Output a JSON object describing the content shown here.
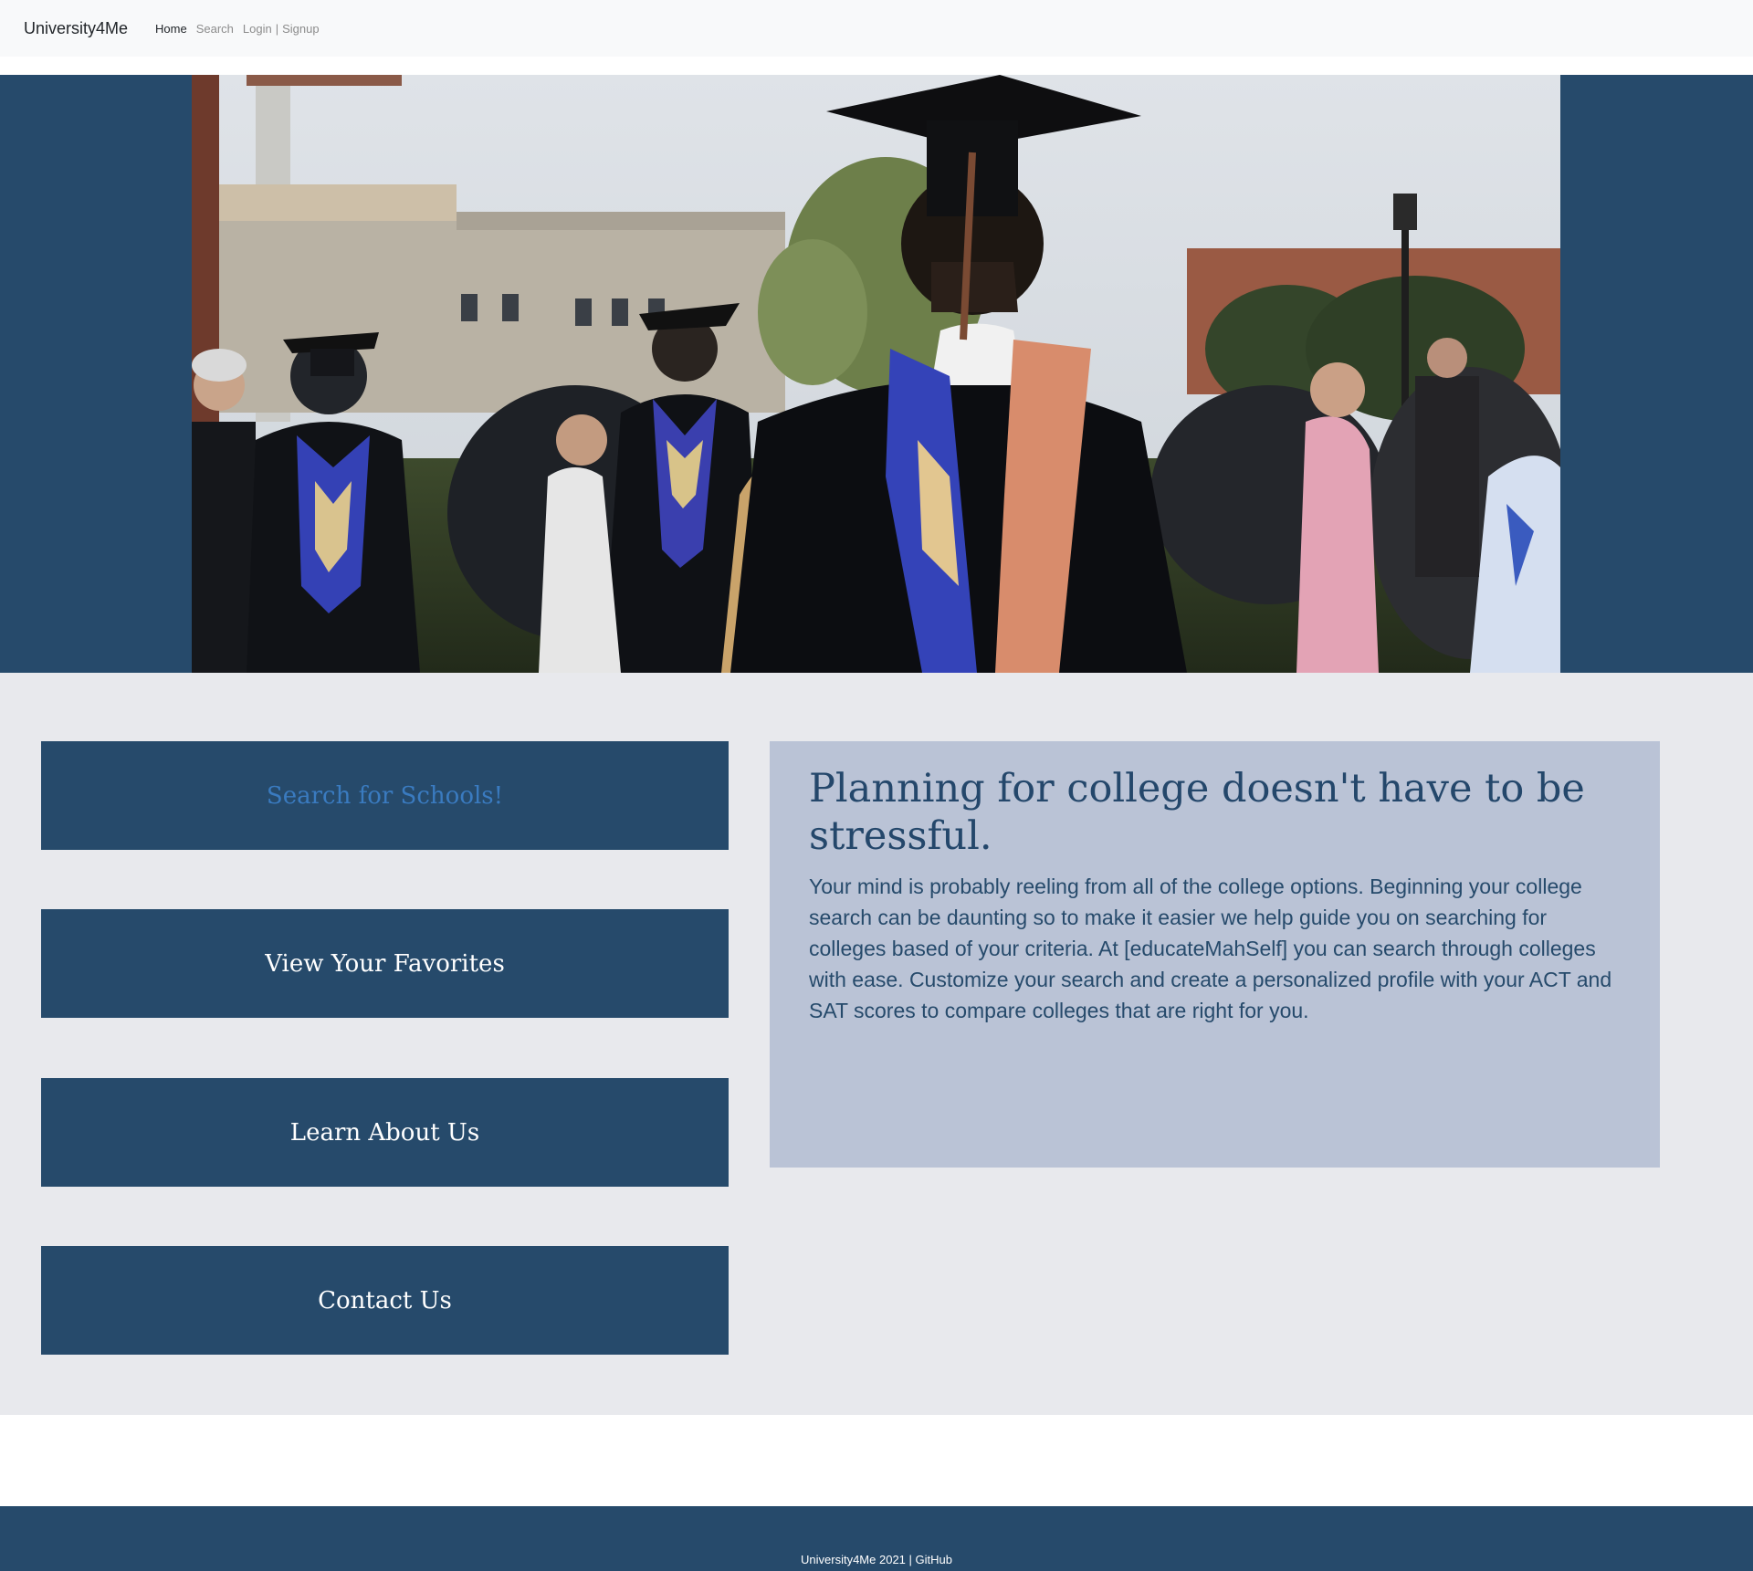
{
  "navbar": {
    "brand": "University4Me",
    "links": {
      "home": "Home",
      "search": "Search",
      "login": "Login",
      "separator": "|",
      "signup": "Signup"
    }
  },
  "hero": {
    "image": "graduation-ceremony-photo"
  },
  "actions": [
    {
      "label": "Search for Schools!"
    },
    {
      "label": "View Your Favorites"
    },
    {
      "label": "Learn About Us"
    },
    {
      "label": "Contact Us"
    }
  ],
  "info": {
    "heading": "Planning for college doesn't have to be stressful.",
    "body": "Your mind is probably reeling from all of the college options. Beginning your college search can be daunting so to make it easier we help guide you on searching for colleges based of your criteria. At [educateMahSelf] you can search through colleges with ease. Customize your search and create a personalized profile with your ACT and SAT scores to compare colleges that are right for you."
  },
  "footer": {
    "text": "University4Me 2021 |",
    "github": "GitHub"
  },
  "colors": {
    "primary": "#264a6b",
    "panel": "#bac3d6",
    "background": "#e8e9ed",
    "highlight_link": "#3a7bc0"
  }
}
